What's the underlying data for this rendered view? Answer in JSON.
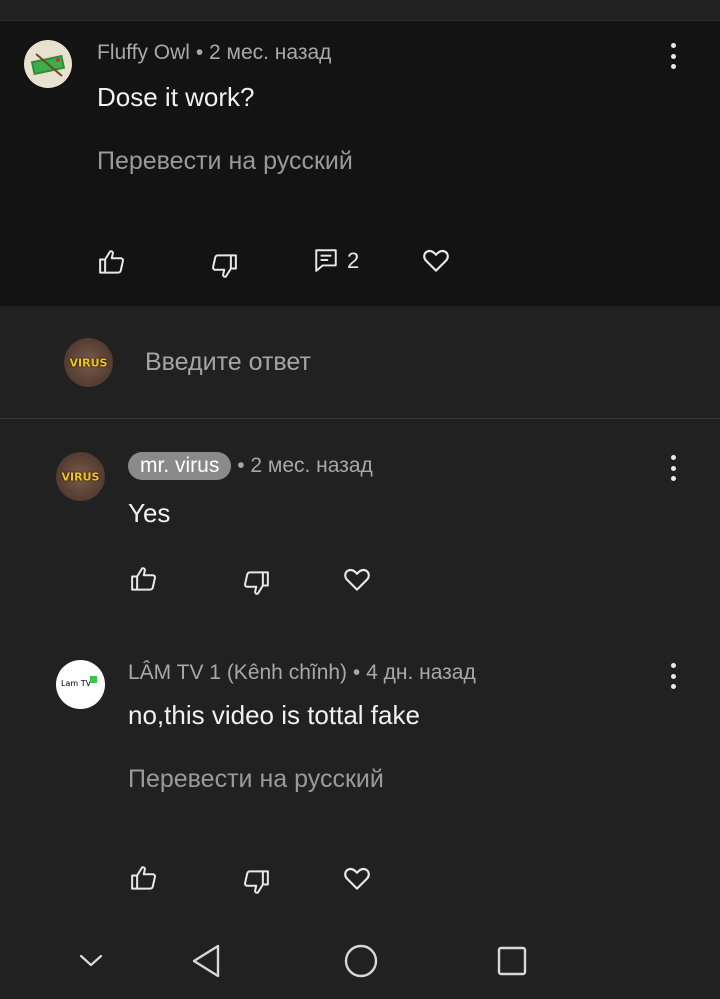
{
  "comment": {
    "author": "Fluffy Owl",
    "time": "• 2 мес. назад",
    "text": "Dose it work?",
    "translate": "Перевести на русский",
    "reply_count": "2"
  },
  "reply_input": {
    "placeholder": "Введите ответ",
    "avatar_text": "VIRUS"
  },
  "replies": [
    {
      "author": "mr. virus",
      "time": "• 2 мес. назад",
      "text": "Yes",
      "avatar_text": "VIRUS"
    },
    {
      "author": "LÂM TV 1 (Kênh chĩnh)",
      "time": "• 4 дн. назад",
      "text": "no,this video is tottal fake",
      "translate": "Перевести на русский",
      "avatar_text": "Lam TV"
    }
  ],
  "colors": {
    "background": "#212121",
    "comment_background": "#131313",
    "chip": "#8a8a8a",
    "avatar_text": "#f3c21b"
  }
}
